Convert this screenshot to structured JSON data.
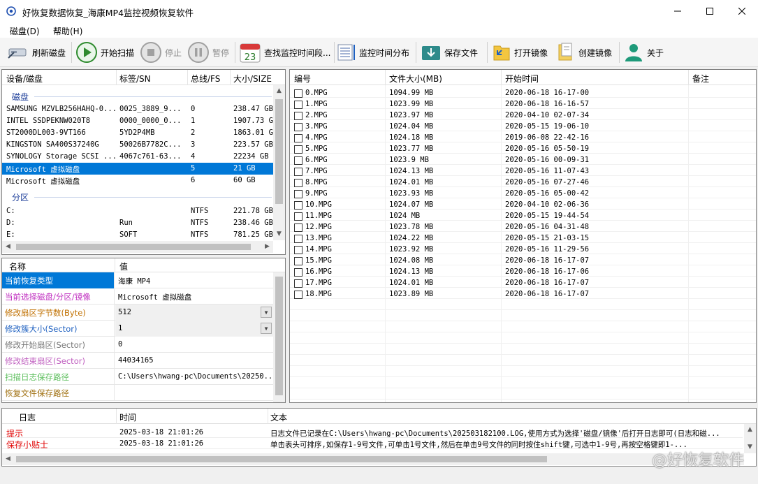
{
  "window": {
    "title": "好恢复数据恢复_海康MP4监控视频恢复软件"
  },
  "menu": {
    "items": [
      "磁盘(D)",
      "帮助(H)"
    ]
  },
  "toolbar": {
    "refresh": "刷新磁盘",
    "start_scan": "开始扫描",
    "stop": "停止",
    "pause": "暂停",
    "find_time": "查找监控时间段...",
    "time_dist": "监控时间分布",
    "save_file": "保存文件",
    "open_image": "打开镜像",
    "create_image": "创建镜像",
    "about": "关于"
  },
  "disk_panel": {
    "headers": [
      "设备/磁盘",
      "标签/SN",
      "总线/FS",
      "大小/SIZE"
    ],
    "group_disk": "磁盘",
    "group_part": "分区",
    "disks": [
      {
        "name": "SAMSUNG MZVLB256HAHQ-0...",
        "sn": "0025_3889_9...",
        "bus": "0",
        "size": "238.47 GB"
      },
      {
        "name": "INTEL SSDPEKNW020T8",
        "sn": "0000_0000_0...",
        "bus": "1",
        "size": "1907.73 GB"
      },
      {
        "name": "ST2000DL003-9VT166",
        "sn": "5YD2P4MB",
        "bus": "2",
        "size": "1863.01 GB"
      },
      {
        "name": "KINGSTON SA400S37240G",
        "sn": "50026B7782C...",
        "bus": "3",
        "size": "223.57 GB"
      },
      {
        "name": "SYNOLOGY Storage SCSI ...",
        "sn": "4067c761-63...",
        "bus": "4",
        "size": "22234 GB"
      },
      {
        "name": "Microsoft 虚拟磁盘",
        "sn": "",
        "bus": "5",
        "size": "21 GB"
      },
      {
        "name": "Microsoft 虚拟磁盘",
        "sn": "",
        "bus": "6",
        "size": "60 GB"
      }
    ],
    "partitions": [
      {
        "name": "C:",
        "sn": "",
        "bus": "NTFS",
        "size": "221.78 GB"
      },
      {
        "name": "D:",
        "sn": "Run",
        "bus": "NTFS",
        "size": "238.46 GB"
      },
      {
        "name": "E:",
        "sn": "SOFT",
        "bus": "NTFS",
        "size": "781.25 GB"
      }
    ]
  },
  "props": {
    "headers": [
      "名称",
      "值"
    ],
    "rows": [
      {
        "name": "当前恢复类型",
        "value": "海康 MP4",
        "color": "#ffffff"
      },
      {
        "name": "当前选择磁盘/分区/镜像",
        "value": "Microsoft 虚拟磁盘",
        "color": "#c030c0"
      },
      {
        "name": "修改扇区字节数(Byte)",
        "value": "512",
        "color": "#c07000"
      },
      {
        "name": "修改簇大小(Sector)",
        "value": "1",
        "color": "#1e60c0"
      },
      {
        "name": "修改开始扇区(Sector)",
        "value": "0",
        "color": "#777777"
      },
      {
        "name": "修改结束扇区(Sector)",
        "value": "44034165",
        "color": "#c060c0"
      },
      {
        "name": "扫描日志保存路径",
        "value": "C:\\Users\\hwang-pc\\Documents\\20250...",
        "color": "#60c060"
      },
      {
        "name": "恢复文件保存路径",
        "value": "",
        "color": "#a07010"
      }
    ]
  },
  "files": {
    "headers": [
      "编号",
      "文件大小(MB)",
      "开始时间",
      "备注"
    ],
    "rows": [
      {
        "name": "0.MPG",
        "size": "1094.99 MB",
        "time": "2020-06-18 16-17-00"
      },
      {
        "name": "1.MPG",
        "size": "1023.99 MB",
        "time": "2020-06-18 16-16-57"
      },
      {
        "name": "2.MPG",
        "size": "1023.97 MB",
        "time": "2020-04-10 02-07-34"
      },
      {
        "name": "3.MPG",
        "size": "1024.04 MB",
        "time": "2020-05-15 19-06-10"
      },
      {
        "name": "4.MPG",
        "size": "1024.18 MB",
        "time": "2019-06-08 22-42-16"
      },
      {
        "name": "5.MPG",
        "size": "1023.77 MB",
        "time": "2020-05-16 05-50-19"
      },
      {
        "name": "6.MPG",
        "size": "1023.9 MB",
        "time": "2020-05-16 00-09-31"
      },
      {
        "name": "7.MPG",
        "size": "1024.13 MB",
        "time": "2020-05-16 11-07-43"
      },
      {
        "name": "8.MPG",
        "size": "1024.01 MB",
        "time": "2020-05-16 07-27-46"
      },
      {
        "name": "9.MPG",
        "size": "1023.93 MB",
        "time": "2020-05-16 05-00-42"
      },
      {
        "name": "10.MPG",
        "size": "1024.07 MB",
        "time": "2020-04-10 02-06-36"
      },
      {
        "name": "11.MPG",
        "size": "1024 MB",
        "time": "2020-05-15 19-44-54"
      },
      {
        "name": "12.MPG",
        "size": "1023.78 MB",
        "time": "2020-05-16 04-31-48"
      },
      {
        "name": "13.MPG",
        "size": "1024.22 MB",
        "time": "2020-05-15 21-03-15"
      },
      {
        "name": "14.MPG",
        "size": "1023.92 MB",
        "time": "2020-05-16 11-29-56"
      },
      {
        "name": "15.MPG",
        "size": "1024.08 MB",
        "time": "2020-06-18 16-17-07"
      },
      {
        "name": "16.MPG",
        "size": "1024.13 MB",
        "time": "2020-06-18 16-17-06"
      },
      {
        "name": "17.MPG",
        "size": "1024.01 MB",
        "time": "2020-06-18 16-17-07"
      },
      {
        "name": "18.MPG",
        "size": "1023.89 MB",
        "time": "2020-06-18 16-17-07"
      }
    ]
  },
  "log": {
    "headers": [
      "日志",
      "时间",
      "文本"
    ],
    "rows": [
      {
        "type": "提示",
        "time": "2025-03-18 21:01:26",
        "text": "日志文件已记录在C:\\Users\\hwang-pc\\Documents\\202503182100.LOG,使用方式为选择'磁盘/镜像'后打开日志即可(日志和磁..."
      },
      {
        "type": "保存小贴士",
        "time": "2025-03-18 21:01:26",
        "text": "单击表头可排序,如保存1-9号文件,可单击1号文件,然后在单击9号文件的同时按住shift键,可选中1-9号,再按空格键即1-..."
      }
    ]
  },
  "watermark": "@好恢复软件",
  "calendar_badge": "23",
  "colors": {
    "accent": "#0078d7",
    "log_red": "#e00000"
  }
}
